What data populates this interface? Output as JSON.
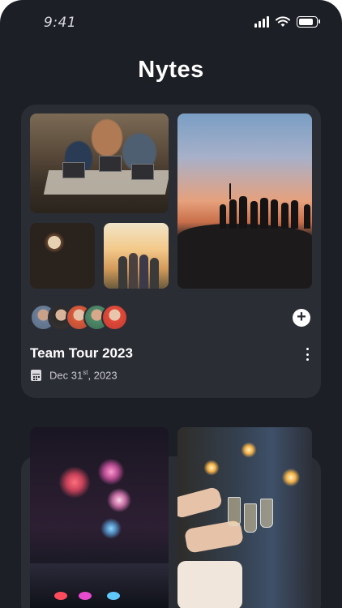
{
  "status_bar": {
    "time": "9:41"
  },
  "app": {
    "title": "Nytes"
  },
  "cards": [
    {
      "title": "Team Tour 2023",
      "date": {
        "main": "Dec 31",
        "suffix": "st",
        "year": ", 2023"
      },
      "photos": [
        "office-photo",
        "sunset-group-photo",
        "coffee-cups-photo",
        "friends-sunset-photo"
      ],
      "members": [
        "avatar-1",
        "avatar-2",
        "avatar-3",
        "avatar-4",
        "avatar-5"
      ],
      "add_icon": "plus-icon",
      "menu_icon": "more-vertical-icon"
    },
    {
      "photos": [
        "fireworks-photo",
        "party-sparklers-photo"
      ]
    }
  ],
  "colors": {
    "background": "#1d1f26",
    "card": "#2b2d35",
    "text_primary": "#ffffff",
    "text_secondary": "#c9c9cf"
  }
}
